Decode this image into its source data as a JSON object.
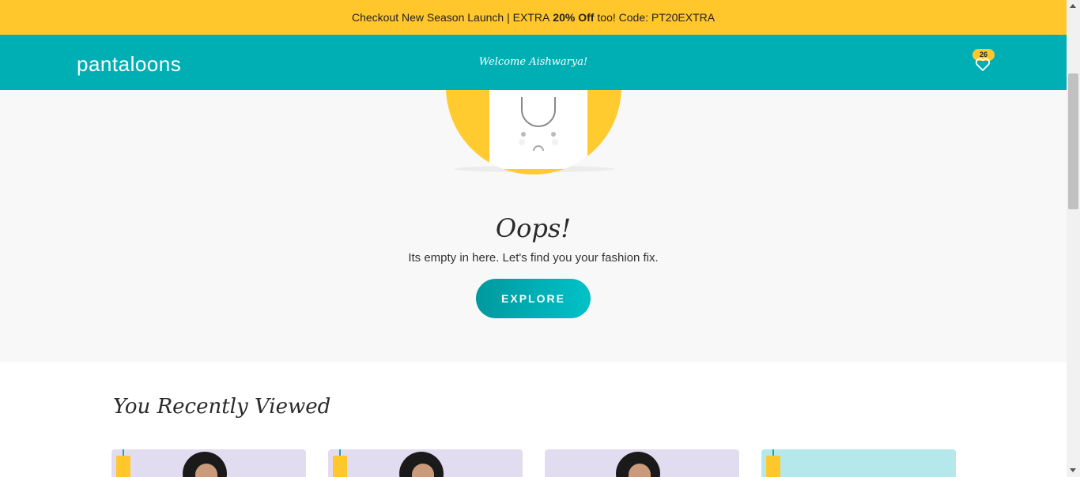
{
  "promo": {
    "text_before": "Checkout New Season Launch | EXTRA",
    "bold": "20% Off",
    "text_after": "too! Code: PT20EXTRA"
  },
  "header": {
    "logo": "pantaloons",
    "welcome": "Welcome Aishwarya!",
    "wishlist_count": "26"
  },
  "empty_state": {
    "title": "Oops!",
    "message": "Its empty in here. Let's find you your fashion fix.",
    "button": "EXPLORE"
  },
  "recently_viewed": {
    "title": "You Recently Viewed"
  },
  "colors": {
    "promo_bg": "#ffc72c",
    "header_bg": "#00afb4",
    "accent": "#00afb4"
  }
}
